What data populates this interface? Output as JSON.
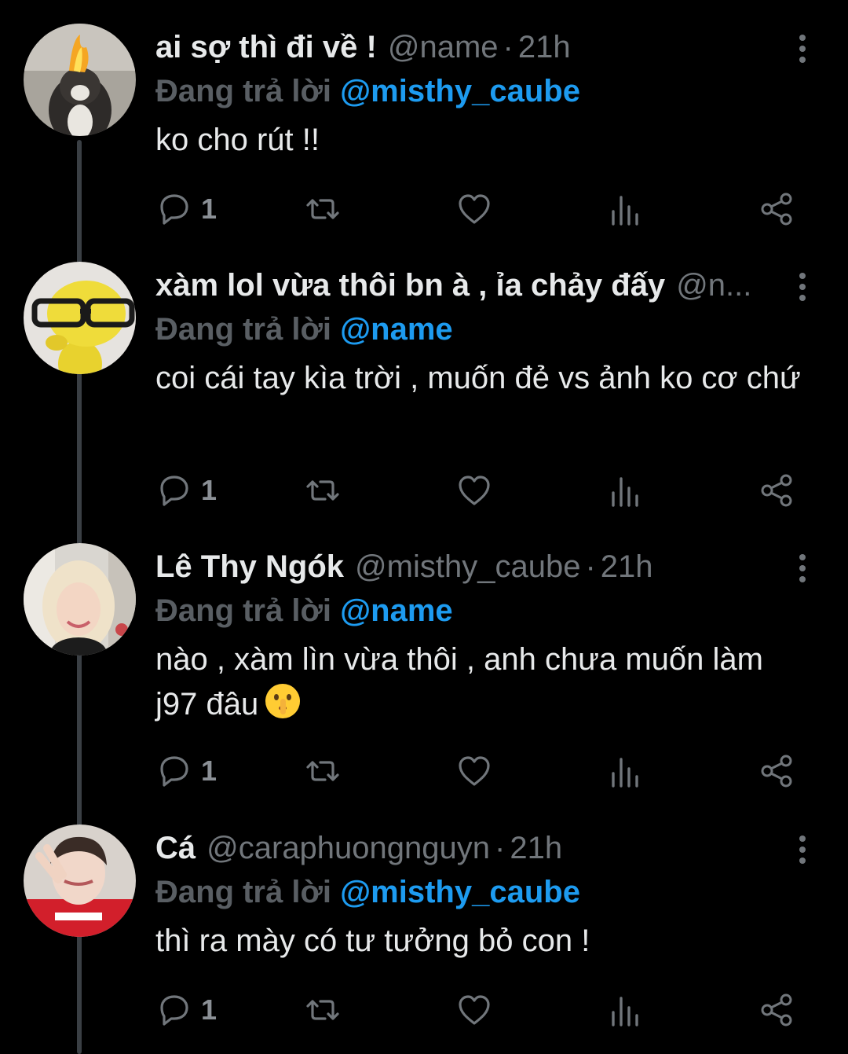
{
  "tweets": [
    {
      "name": "ai sợ thì đi về !",
      "handle": "@name",
      "separator": "·",
      "time": "21h",
      "replying_label": "Đang trả lời",
      "replying_to": "@misthy_caube",
      "text": "ko cho rút !!",
      "reply_count": "1",
      "avatar": "cat-with-fire-avatar"
    },
    {
      "name": "xàm lol vừa thôi bn à , ỉa chảy đấy",
      "handle": "@n...",
      "separator": "",
      "time": "",
      "replying_label": "Đang trả lời",
      "replying_to": "@name",
      "text": "coi cái tay kìa trời , muốn đẻ vs ảnh ko cơ chứ",
      "reply_count": "1",
      "avatar": "yellow-figure-glasses-avatar"
    },
    {
      "name": "Lê Thy Ngók",
      "handle": "@misthy_caube",
      "separator": "·",
      "time": "21h",
      "replying_label": "Đang trả lời",
      "replying_to": "@name",
      "text": "nào , xàm lìn vừa thôi , anh chưa muốn làm j97 đâu",
      "emoji": "shushing-face-emoji",
      "reply_count": "1",
      "avatar": "blonde-girl-avatar"
    },
    {
      "name": "Cá",
      "handle": "@caraphuongnguyn",
      "separator": "·",
      "time": "21h",
      "replying_label": "Đang trả lời",
      "replying_to": "@misthy_caube",
      "text": "thì ra mày có tư tưởng bỏ con !",
      "reply_count": "1",
      "avatar": "girl-red-shirt-avatar"
    }
  ],
  "icons": {
    "more": "more-vertical-icon",
    "reply": "reply-icon",
    "retweet": "retweet-icon",
    "like": "heart-icon",
    "views": "views-icon",
    "share": "share-icon"
  },
  "colors": {
    "background": "#000000",
    "text": "#e7e9ea",
    "muted": "#71767b",
    "mention": "#1d9bf0"
  }
}
